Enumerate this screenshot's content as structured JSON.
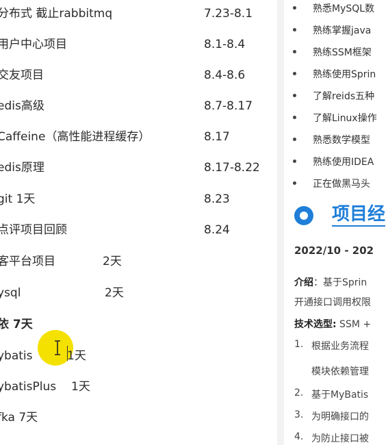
{
  "left_pane": {
    "rows": [
      {
        "task": "分布式 截止rabbitmq",
        "date": "7.23-8.1"
      },
      {
        "task": "用户中心项目",
        "date": "8.1-8.4"
      },
      {
        "task": "交友项目",
        "date": "8.4-8.6"
      },
      {
        "task": "edis高级",
        "date": "8.7-8.17"
      },
      {
        "task": "Caffeine（高性能进程缓存）",
        "date": "8.17"
      },
      {
        "task": "edis原理",
        "date": "8.17-8.22"
      },
      {
        "task": "git 1天",
        "date": "8.23"
      },
      {
        "task": "点评项目回顾",
        "date": "8.24"
      },
      {
        "task": "客平台项目",
        "date": "2天"
      },
      {
        "task": "ysql",
        "date": "2天"
      },
      {
        "task": "依  7天",
        "date": ""
      },
      {
        "task": "ybatis",
        "date": "1天"
      },
      {
        "task": "ybatisPlus",
        "date": "1天"
      },
      {
        "task": "fka  7天",
        "date": ""
      }
    ]
  },
  "right_pane": {
    "bullets": [
      "熟悉MySQL数",
      "熟练掌握java",
      "熟练SSM框架",
      "熟练使用Sprin",
      "了解reids五种",
      "了解Linux操作",
      "熟悉数学模型",
      "熟练使用IDEA",
      "正在做黑马头"
    ],
    "section_title": "项目经",
    "period": "2022/10 - 202",
    "intro_label": "介绍",
    "intro_text": "：基于Sprin",
    "intro_cont": "开通接口调用权限",
    "tech_label": "技术选型:",
    "tech_text": " SSM +",
    "items": [
      {
        "num": "1.",
        "text": "根据业务流程"
      },
      {
        "num": "",
        "text": "模块依赖管理"
      },
      {
        "num": "2.",
        "text": "基于MyBatis"
      },
      {
        "num": "3.",
        "text": "为明确接口的"
      },
      {
        "num": "4.",
        "text": "为防止接口被"
      }
    ]
  },
  "colors": {
    "accent": "#1f7ed8",
    "cursor_highlight": "#f5e100"
  }
}
